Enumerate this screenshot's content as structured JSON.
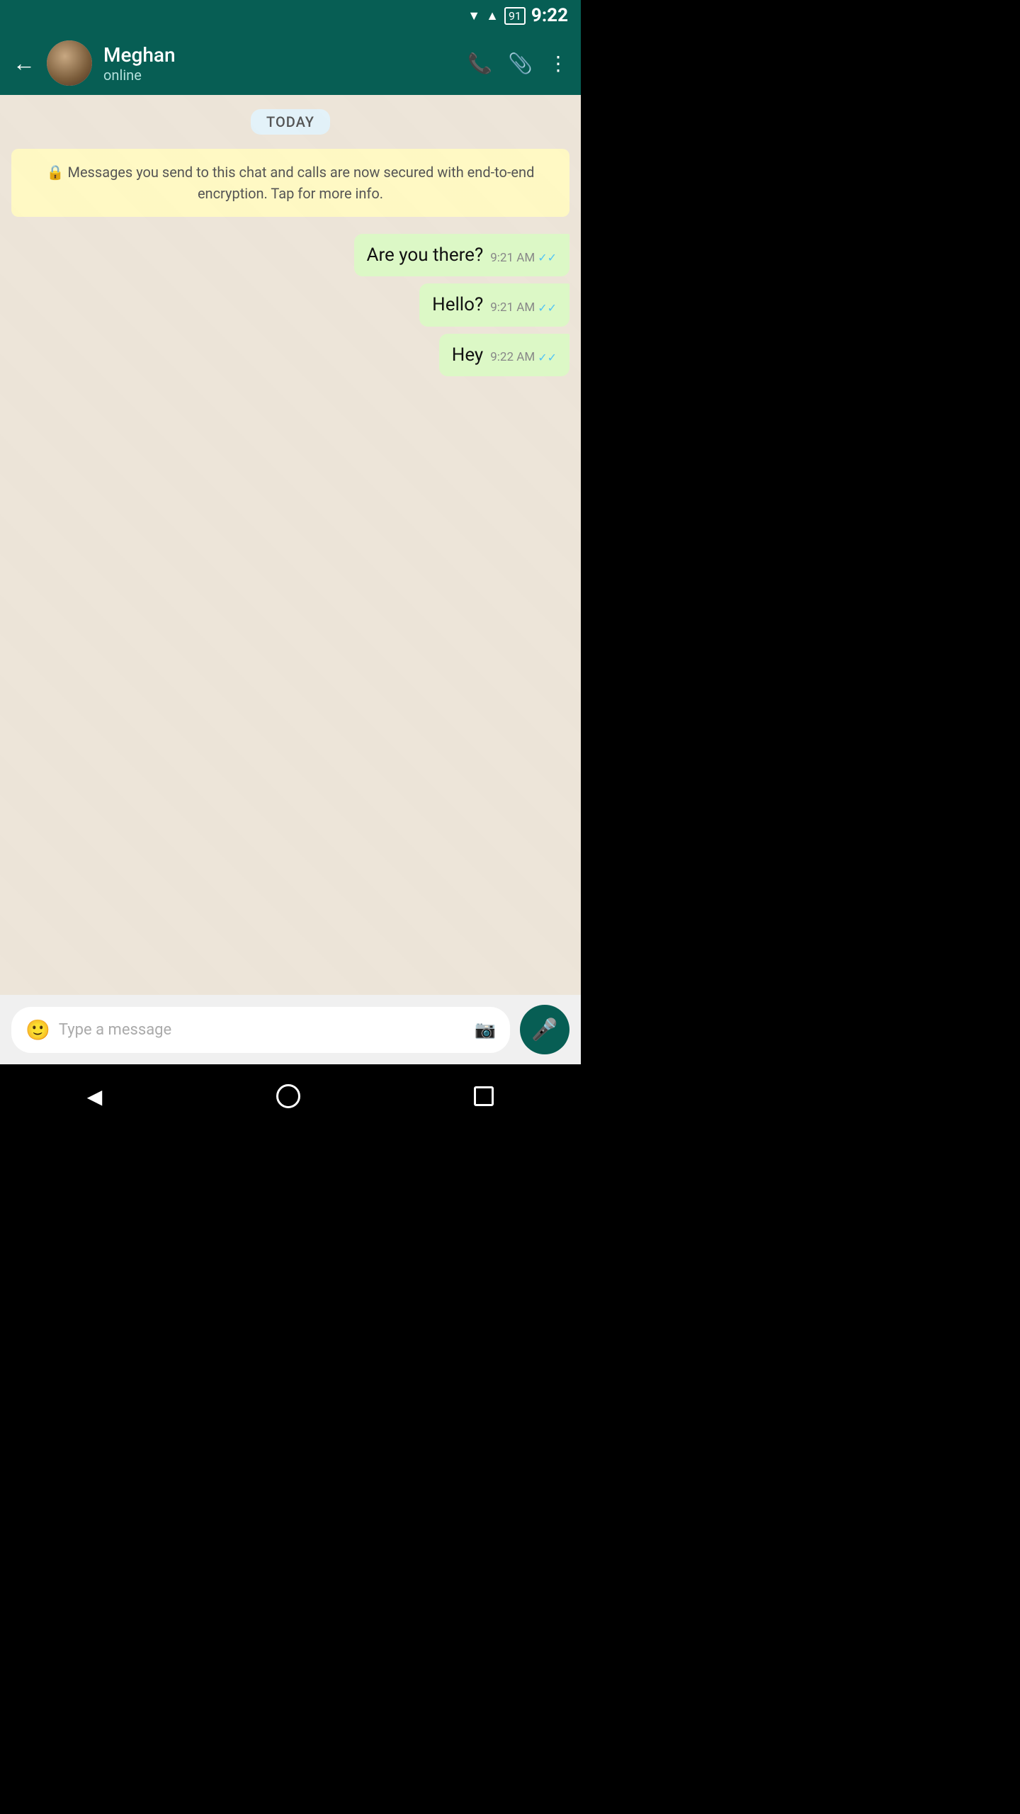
{
  "statusBar": {
    "time": "9:22",
    "batteryLevel": "91"
  },
  "header": {
    "contactName": "Meghan",
    "contactStatus": "online",
    "backLabel": "←"
  },
  "chat": {
    "dateSeparator": "TODAY",
    "encryptionNotice": "🔒 Messages you send to this chat and calls are now secured with end-to-end encryption. Tap for more info.",
    "messages": [
      {
        "id": 1,
        "text": "Are you there?",
        "time": "9:21 AM",
        "type": "sent",
        "ticks": "✓✓"
      },
      {
        "id": 2,
        "text": "Hello?",
        "time": "9:21 AM",
        "type": "sent",
        "ticks": "✓✓"
      },
      {
        "id": 3,
        "text": "Hey",
        "time": "9:22 AM",
        "type": "sent",
        "ticks": "✓✓"
      }
    ]
  },
  "inputBar": {
    "placeholder": "Type a message"
  }
}
